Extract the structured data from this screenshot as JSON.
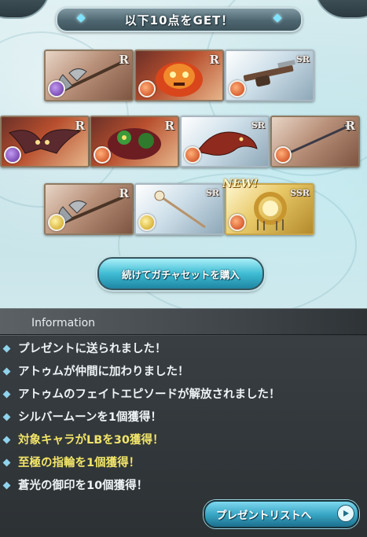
{
  "header": {
    "title": "以下10点をGET！"
  },
  "items": [
    {
      "rarity": "R",
      "element": "dark",
      "icon": "axe-weapon"
    },
    {
      "rarity": "R",
      "element": "fire",
      "icon": "fire-spirit"
    },
    {
      "rarity": "SR",
      "element": "fire",
      "icon": "gun-weapon"
    },
    {
      "rarity": "R",
      "element": "dark",
      "icon": "bat-creature"
    },
    {
      "rarity": "R",
      "element": "fire",
      "icon": "green-flower-monster"
    },
    {
      "rarity": "SR",
      "element": "fire",
      "icon": "red-dragon"
    },
    {
      "rarity": "R",
      "element": "fire",
      "icon": "spear-weapon"
    },
    {
      "rarity": "R",
      "element": "light",
      "icon": "axe-weapon"
    },
    {
      "rarity": "SR",
      "element": "light",
      "icon": "staff-weapon"
    },
    {
      "rarity": "SSR",
      "element": "fire",
      "icon": "golden-ring",
      "new_label": "NEW!"
    }
  ],
  "buttons": {
    "continue_label": "続けてガチャセットを購入",
    "present_list_label": "プレゼントリストへ"
  },
  "info": {
    "title": "Information",
    "messages": [
      {
        "text": "プレゼントに送られました！",
        "highlight": false
      },
      {
        "text": "アトゥムが仲間に加わりました！",
        "highlight": false
      },
      {
        "text": "アトゥムのフェイトエピソードが解放されました！",
        "highlight": false
      },
      {
        "text": "シルバームーンを1個獲得！",
        "highlight": false
      },
      {
        "text": "対象キャラがLBを30獲得！",
        "highlight": true
      },
      {
        "text": "至極の指輪を1個獲得！",
        "highlight": true
      },
      {
        "text": "蒼光の御印を10個獲得！",
        "highlight": false
      }
    ]
  },
  "colors": {
    "highlight": "#f2e46a",
    "button_cyan": "#3fbcd4"
  }
}
